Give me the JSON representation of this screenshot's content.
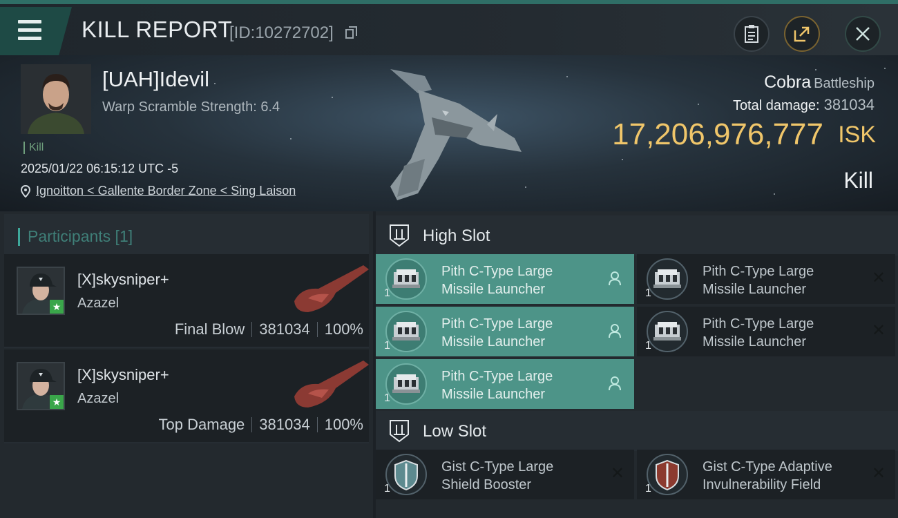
{
  "header": {
    "title": "KILL REPORT",
    "report_id": "[ID:10272702]"
  },
  "victim": {
    "name": "[UAH]Idevil",
    "warp_scramble": "Warp Scramble Strength: 6.4",
    "kill_tag": "Kill",
    "datetime": "2025/01/22 06:15:12 UTC -5",
    "location": "Ignoitton < Gallente Border Zone < Sing Laison",
    "ship_name": "Cobra",
    "ship_class": "Battleship",
    "total_damage_label": "Total damage:",
    "total_damage_value": "381034",
    "isk_value": "17,206,976,777",
    "isk_unit": "ISK",
    "result": "Kill"
  },
  "participants": {
    "title": "Participants [1]",
    "rows": [
      {
        "name": "[X]skysniper+",
        "ship": "Azazel",
        "role": "Final Blow",
        "damage": "381034",
        "percent": "100%"
      },
      {
        "name": "[X]skysniper+",
        "ship": "Azazel",
        "role": "Top Damage",
        "damage": "381034",
        "percent": "100%"
      }
    ]
  },
  "slots": {
    "high": {
      "title": "High Slot",
      "modules": [
        {
          "qty": "1",
          "name": "Pith C-Type Large Missile Launcher",
          "fitted": true
        },
        {
          "qty": "1",
          "name": "Pith C-Type Large Missile Launcher",
          "fitted": false
        },
        {
          "qty": "1",
          "name": "Pith C-Type Large Missile Launcher",
          "fitted": true
        },
        {
          "qty": "1",
          "name": "Pith C-Type Large Missile Launcher",
          "fitted": false
        },
        {
          "qty": "1",
          "name": "Pith C-Type Large Missile Launcher",
          "fitted": true
        }
      ]
    },
    "low": {
      "title": "Low Slot",
      "modules": [
        {
          "qty": "1",
          "name": "Gist C-Type Large Shield Booster",
          "fitted": false
        },
        {
          "qty": "1",
          "name": "Gist C-Type Adaptive Invulnerability Field",
          "fitted": false
        }
      ]
    }
  },
  "colors": {
    "accent": "#3ea89b",
    "fitted_module": "#4d9488",
    "isk": "#f0c66a"
  },
  "icons": [
    "menu-icon",
    "copy-icon",
    "clipboard-icon",
    "share-icon",
    "close-icon",
    "location-pin-icon",
    "slot-icon",
    "pilot-icon",
    "destroyed-x-icon",
    "star-icon"
  ]
}
